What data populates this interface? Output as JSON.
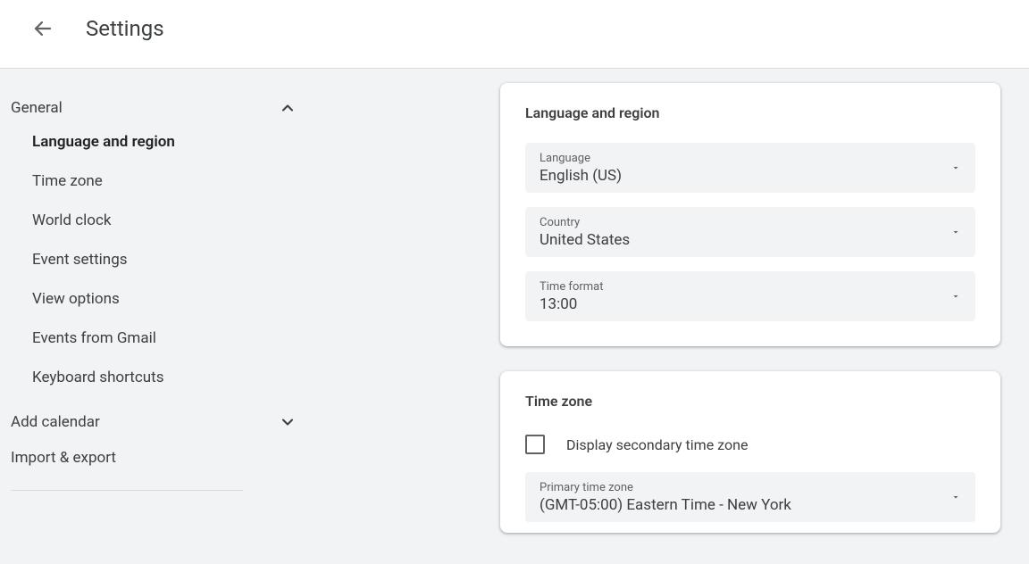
{
  "header": {
    "title": "Settings"
  },
  "sidebar": {
    "sections": [
      {
        "label": "General",
        "expanded": true,
        "items": [
          {
            "label": "Language and region",
            "active": true
          },
          {
            "label": "Time zone"
          },
          {
            "label": "World clock"
          },
          {
            "label": "Event settings"
          },
          {
            "label": "View options"
          },
          {
            "label": "Events from Gmail"
          },
          {
            "label": "Keyboard shortcuts"
          }
        ]
      },
      {
        "label": "Add calendar",
        "expanded": false
      },
      {
        "label": "Import & export",
        "expanded": null
      }
    ]
  },
  "cards": {
    "language_region": {
      "title": "Language and region",
      "fields": [
        {
          "label": "Language",
          "value": "English (US)"
        },
        {
          "label": "Country",
          "value": "United States"
        },
        {
          "label": "Time format",
          "value": "13:00"
        }
      ]
    },
    "time_zone": {
      "title": "Time zone",
      "checkbox_label": "Display secondary time zone",
      "primary": {
        "label": "Primary time zone",
        "value": "(GMT-05:00) Eastern Time - New York"
      }
    }
  }
}
